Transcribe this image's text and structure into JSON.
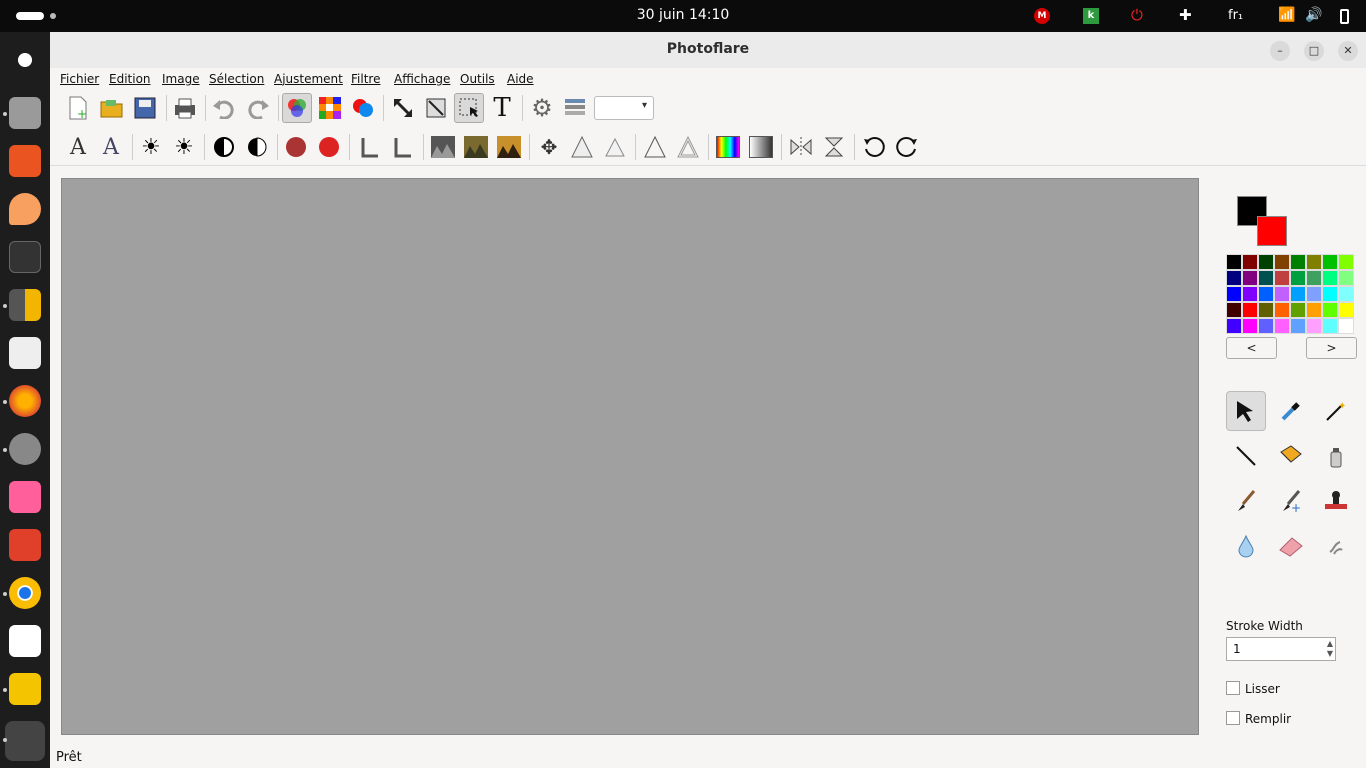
{
  "topbar": {
    "clock": "30 juin  14:10",
    "lang": "fr₁"
  },
  "window": {
    "title": "Photoflare",
    "min": "–",
    "max": "□",
    "close": "✕"
  },
  "menu": [
    "Fichier",
    "Edition",
    "Image",
    "Sélection",
    "Ajustement",
    "Filtre",
    "Affichage",
    "Outils",
    "Aide"
  ],
  "palette_buttons": {
    "prev": "<",
    "next": ">"
  },
  "stroke": {
    "label": "Stroke Width",
    "value": "1"
  },
  "options": {
    "smooth": "Lisser",
    "fill": "Remplir"
  },
  "status": "Prêt",
  "colors": {
    "primary": "#000000",
    "secondary": "#ff0000",
    "canvas": "#a0a0a0"
  },
  "palette": [
    "#000000",
    "#800000",
    "#004000",
    "#804000",
    "#008000",
    "#808000",
    "#00c000",
    "#80ff00",
    "#000080",
    "#800080",
    "#005050",
    "#c04040",
    "#00a040",
    "#40a060",
    "#00ff80",
    "#80ff80",
    "#0000ff",
    "#8000ff",
    "#0060ff",
    "#c060ff",
    "#00a0ff",
    "#80a0ff",
    "#00ffff",
    "#80ffff",
    "#400000",
    "#ff0000",
    "#606000",
    "#ff6000",
    "#60a000",
    "#ffa000",
    "#60ff00",
    "#ffff00",
    "#4000ff",
    "#ff00ff",
    "#6060ff",
    "#ff60ff",
    "#60a0ff",
    "#ffa0ff",
    "#60ffff",
    "#ffffff"
  ]
}
